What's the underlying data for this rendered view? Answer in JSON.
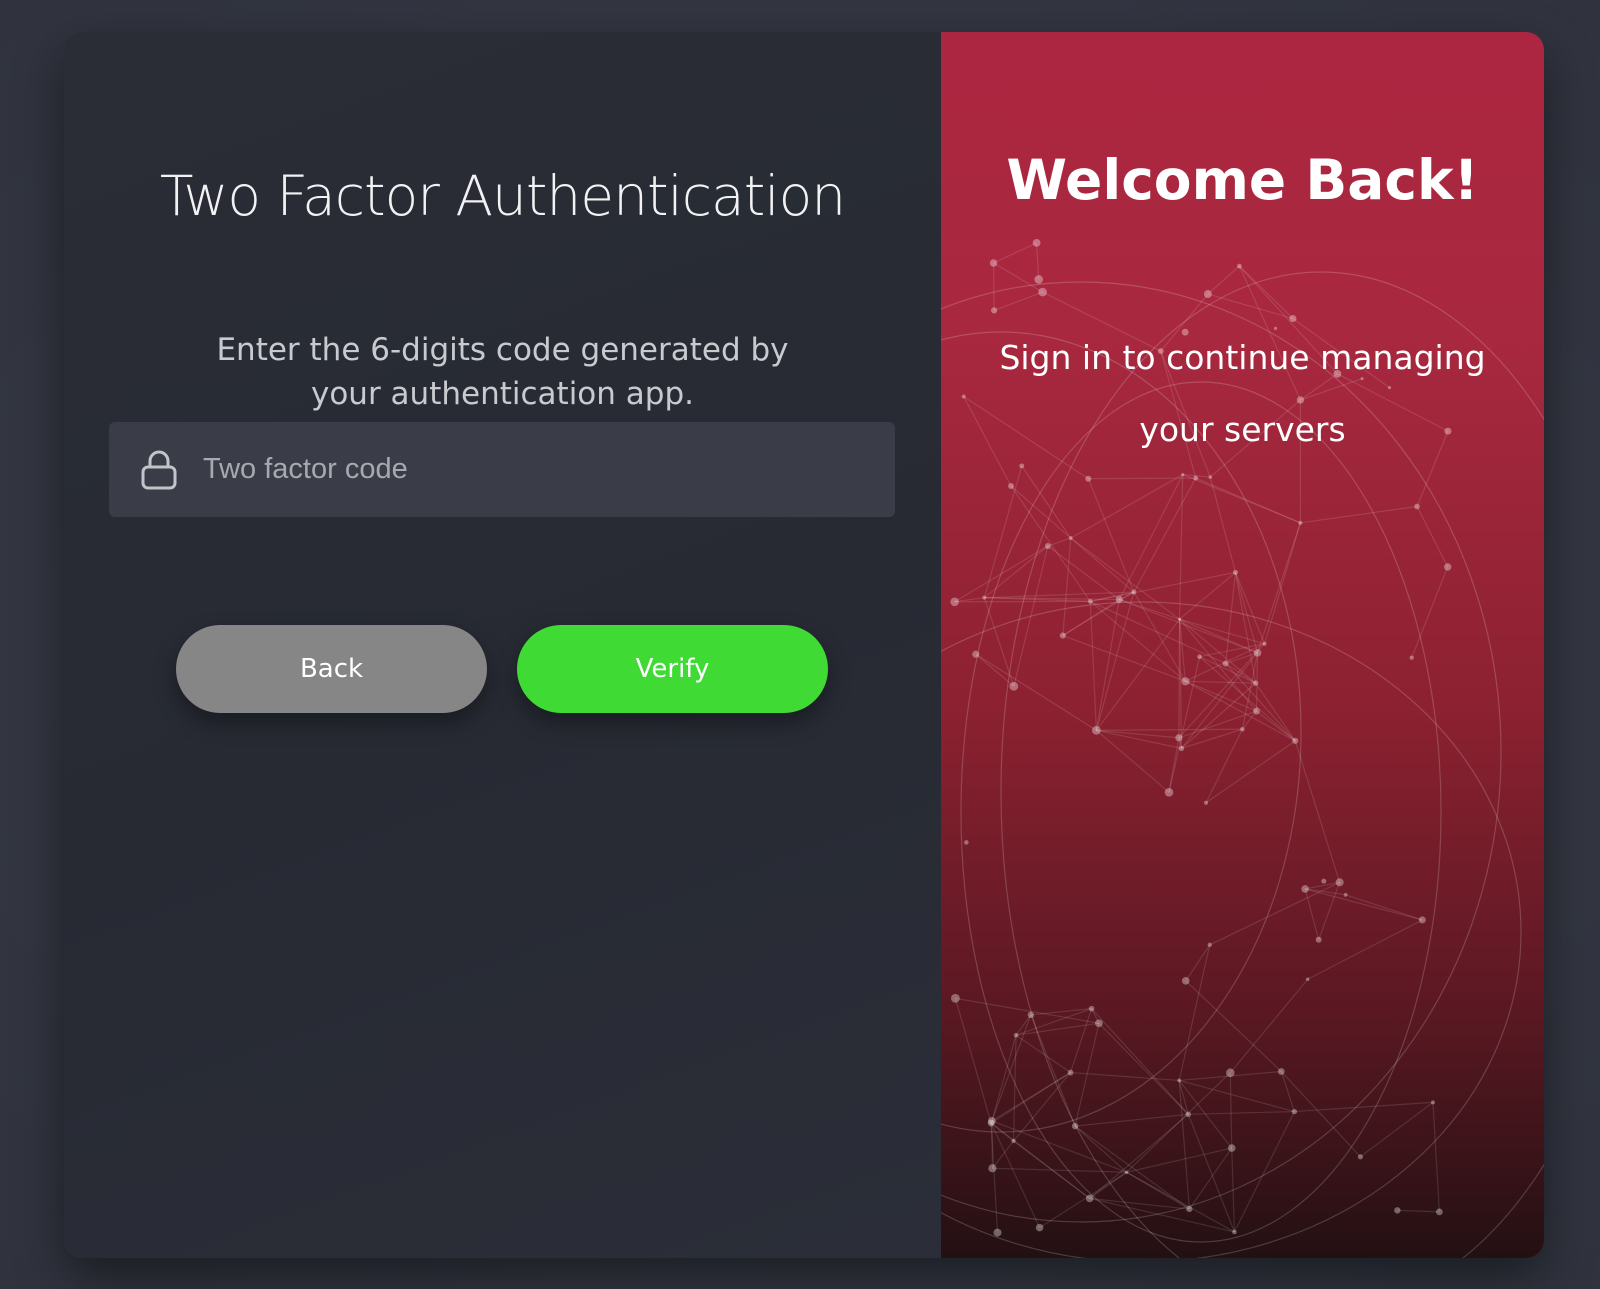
{
  "auth": {
    "title": "Two Factor Authentication",
    "instructions": "Enter the 6-digits code generated by your authentication app.",
    "code_input": {
      "placeholder": "Two factor code",
      "value": "",
      "icon": "lock-icon"
    },
    "back_label": "Back",
    "verify_label": "Verify"
  },
  "welcome": {
    "heading": "Welcome Back!",
    "message": "Sign in to continue managing your servers"
  },
  "colors": {
    "background": "#343743",
    "card_left": "#292c35",
    "input_background": "#3a3d47",
    "back_button": "#868686",
    "verify_button": "#3fdb34",
    "panel_red_top": "#ad2641",
    "panel_red_bottom": "#231012"
  }
}
